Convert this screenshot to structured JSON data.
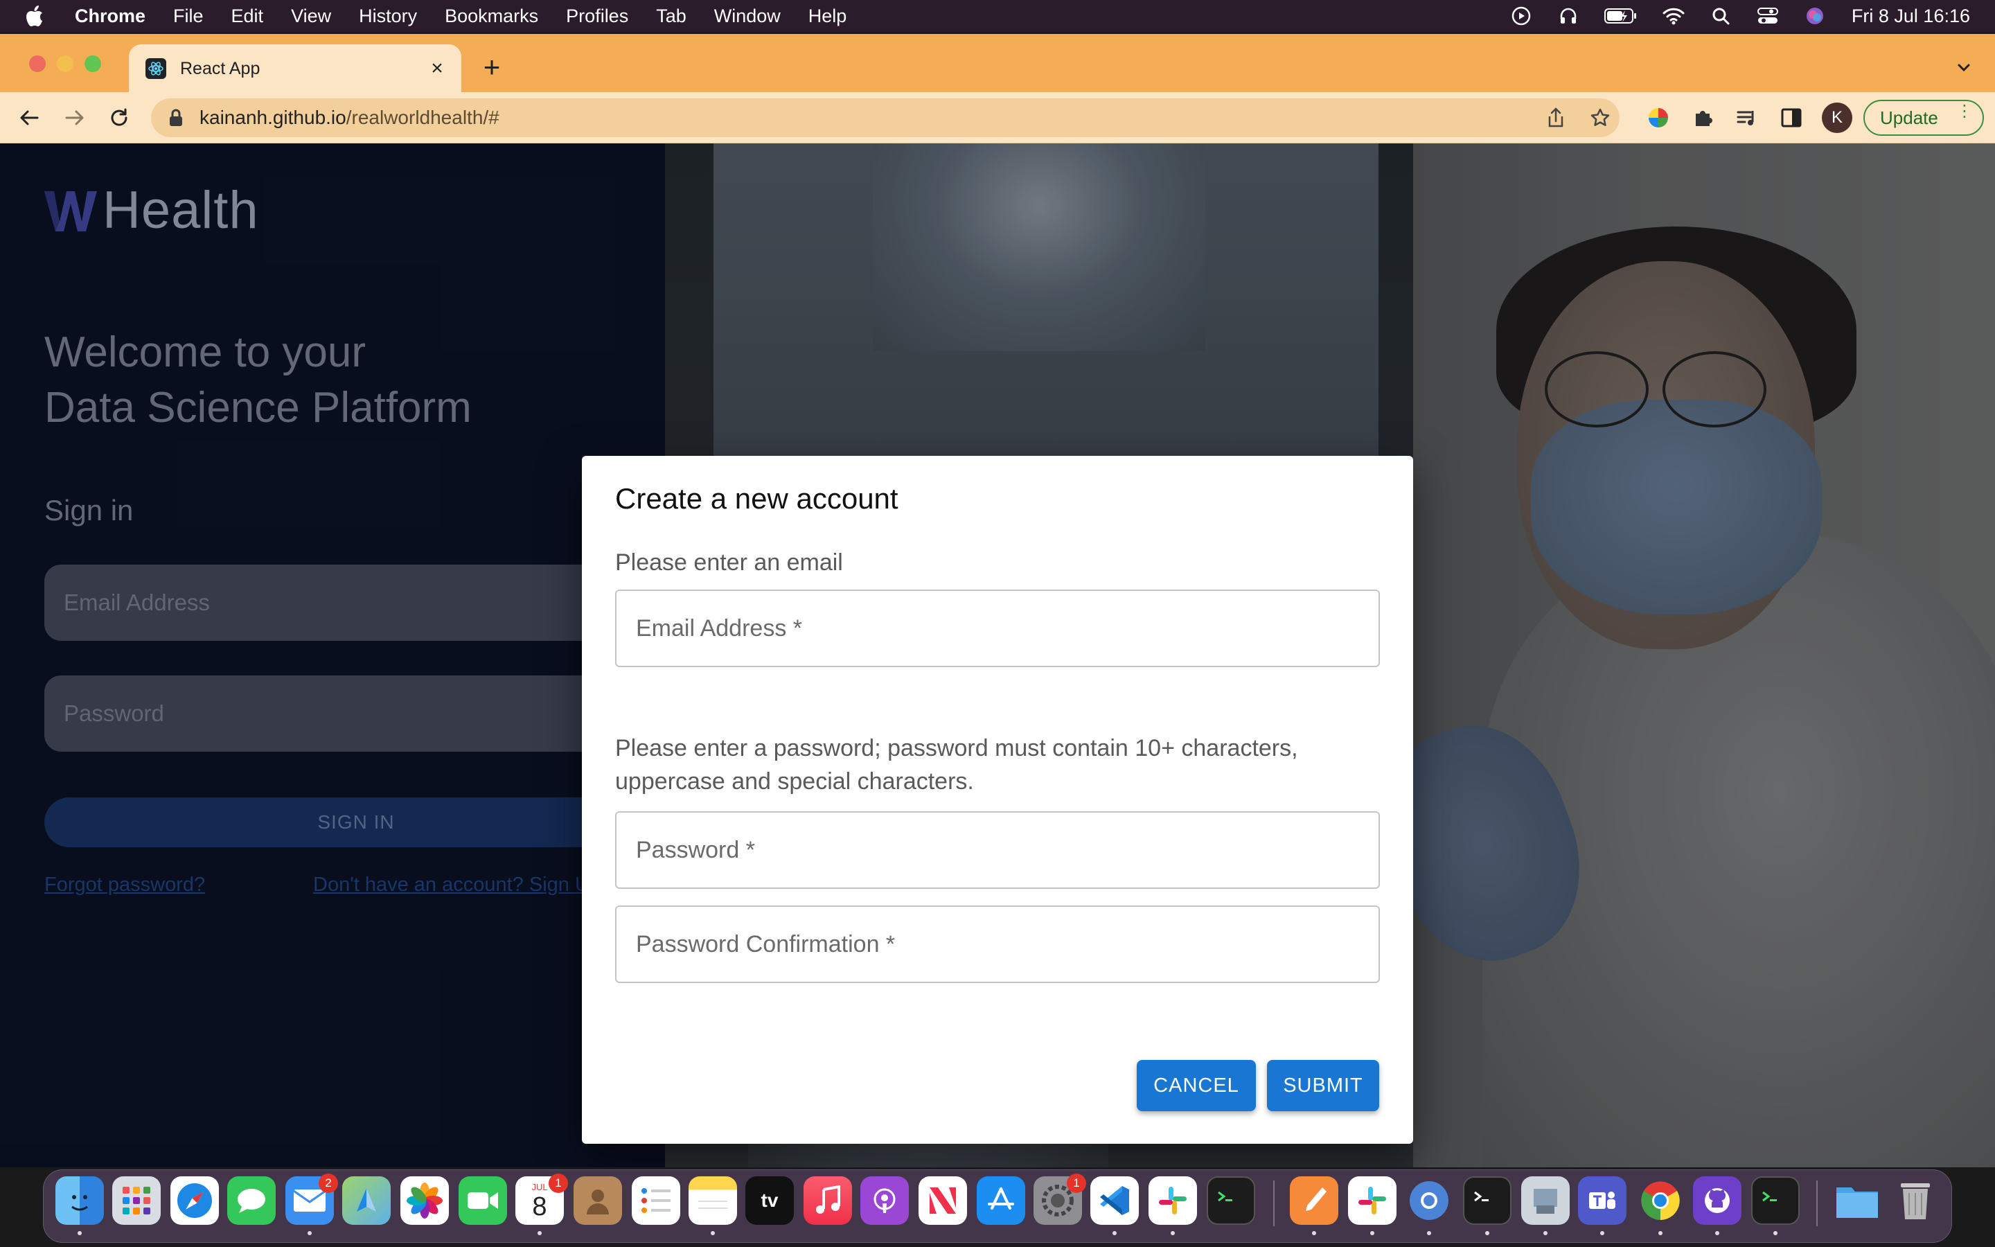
{
  "menubar": {
    "app": "Chrome",
    "items": [
      "File",
      "Edit",
      "View",
      "History",
      "Bookmarks",
      "Profiles",
      "Tab",
      "Window",
      "Help"
    ],
    "clock": "Fri 8 Jul  16:16",
    "status_icons": [
      "play-icon",
      "headphones-icon",
      "battery-icon",
      "wifi-icon",
      "search-icon",
      "control-center-icon",
      "siri-icon"
    ]
  },
  "browser": {
    "tab_title": "React App",
    "url_host": "kainanh.github.io",
    "url_path": "/realworldhealth/#",
    "profile_initial": "K",
    "update_label": "Update"
  },
  "login": {
    "brand": "Health",
    "welcome_line1": "Welcome to your",
    "welcome_line2": "Data Science Platform",
    "signin_title": "Sign in",
    "email_placeholder": "Email Address",
    "password_placeholder": "Password",
    "signin_button": "SIGN IN",
    "forgot_link": "Forgot password?",
    "signup_link": "Don't have an account? Sign Up"
  },
  "modal": {
    "title": "Create a new account",
    "email_prompt": "Please enter an email",
    "email_label": "Email Address *",
    "password_prompt": "Please enter a password; password must contain 10+ characters, uppercase and special characters.",
    "password_label": "Password *",
    "password_confirm_label": "Password Confirmation *",
    "cancel_label": "CANCEL",
    "submit_label": "SUBMIT"
  },
  "dock": {
    "apps": [
      "Finder",
      "Launchpad",
      "Safari",
      "Messages",
      "Mail",
      "Maps",
      "Photos",
      "FaceTime",
      "Calendar",
      "Contacts",
      "Reminders",
      "Notes",
      "TV",
      "Music",
      "Podcasts",
      "News",
      "App Store",
      "System Preferences",
      "Visual Studio Code",
      "Slack",
      "Terminal",
      "Pages",
      "Slack",
      "Chromium",
      "Terminal",
      "Preview",
      "Teams",
      "Chrome",
      "GitHub Desktop",
      "Terminal",
      "Downloads",
      "Trash"
    ],
    "calendar_month": "JUL",
    "calendar_day": "8",
    "mail_badge": "2",
    "calendar_badge": "1",
    "settings_badge": "1",
    "tv_label": "tv"
  },
  "colors": {
    "tabbar": "#f4ad54",
    "toolbar": "#fbe5c4",
    "primary_button": "#1976d2",
    "left_panel": "#0a1022"
  }
}
